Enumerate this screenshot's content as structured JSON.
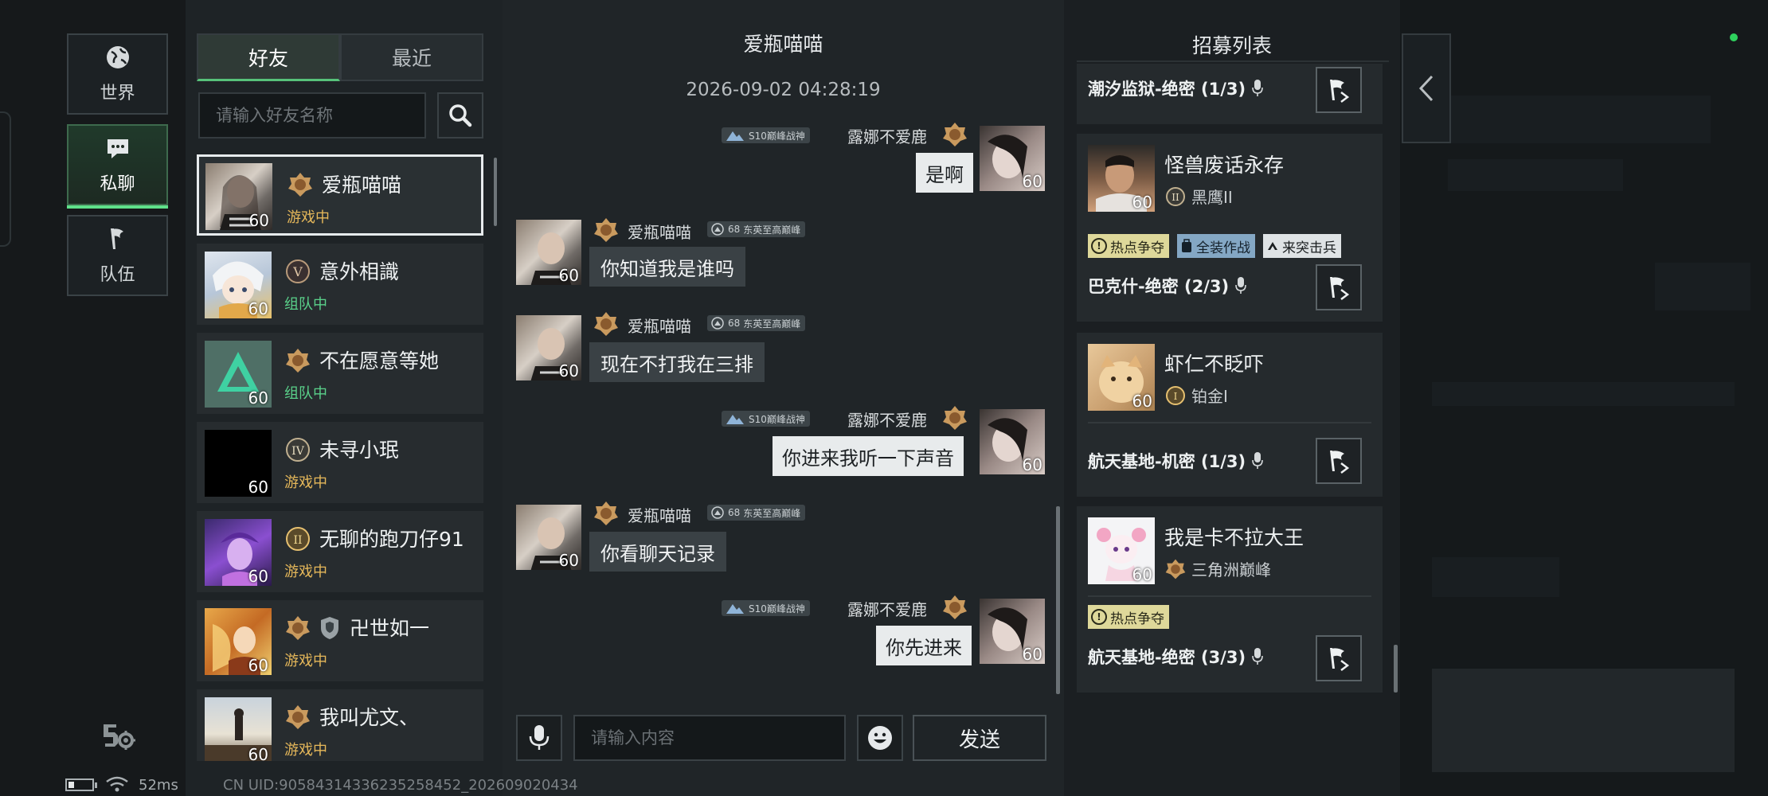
{
  "nav": {
    "world": "世界",
    "private_chat": "私聊",
    "team": "队伍"
  },
  "friends": {
    "tab_friends": "好友",
    "tab_recent": "最近",
    "search_placeholder": "请输入好友名称",
    "list": [
      {
        "name": "爱瓶喵喵",
        "level": "60",
        "status": "游戏中"
      },
      {
        "name": "意外相識",
        "level": "60",
        "status": "组队中"
      },
      {
        "name": "不在愿意等她",
        "level": "60",
        "status": "组队中"
      },
      {
        "name": "未寻小珉",
        "level": "60",
        "status": "游戏中"
      },
      {
        "name": "无聊的跑刀仔91",
        "level": "60",
        "status": "游戏中"
      },
      {
        "name": "卍世如一",
        "level": "60",
        "status": "游戏中"
      },
      {
        "name": "我叫尤文、",
        "level": "60",
        "status": "游戏中"
      }
    ]
  },
  "chat": {
    "title": "爱瓶喵喵",
    "date": "2026-09-02 04:28:19",
    "self_name": "露娜不爱鹿",
    "self_tag": "S10巅峰战神",
    "peer_name": "爱瓶喵喵",
    "peer_tag": "东英至高巅峰",
    "peer_tag_level": "68",
    "level": "60",
    "messages": [
      {
        "text": "是啊"
      },
      {
        "text": "你知道我是谁吗"
      },
      {
        "text": "现在不打我在三排"
      },
      {
        "text": "你进来我听一下声音"
      },
      {
        "text": "你看聊天记录"
      },
      {
        "text": "你先进来"
      }
    ],
    "input_placeholder": "请输入内容",
    "send": "发送"
  },
  "recruit": {
    "title": "招募列表",
    "cards": [
      {
        "mode": "潮汐监狱-绝密 (1/3)"
      },
      {
        "name": "怪兽废话永存",
        "rank": "黑鹰II",
        "level": "60",
        "tags": [
          "热点争夺",
          "全装作战",
          "来突击兵"
        ],
        "mode": "巴克什-绝密 (2/3)"
      },
      {
        "name": "虾仁不眨吓",
        "rank": "铂金I",
        "level": "60",
        "mode": "航天基地-机密 (1/3)"
      },
      {
        "name": "我是卡不拉大王",
        "rank": "三角洲巅峰",
        "level": "60",
        "tags": [
          "热点争夺"
        ],
        "mode": "航天基地-绝密 (3/3)"
      }
    ]
  },
  "status": {
    "ping": "52ms",
    "uid": "CN UID:9058431433623525845​2_202609020434"
  },
  "colors": {
    "accent_green": "#57c27a",
    "status_game": "#e6b85a",
    "status_team": "#5ad18a"
  }
}
